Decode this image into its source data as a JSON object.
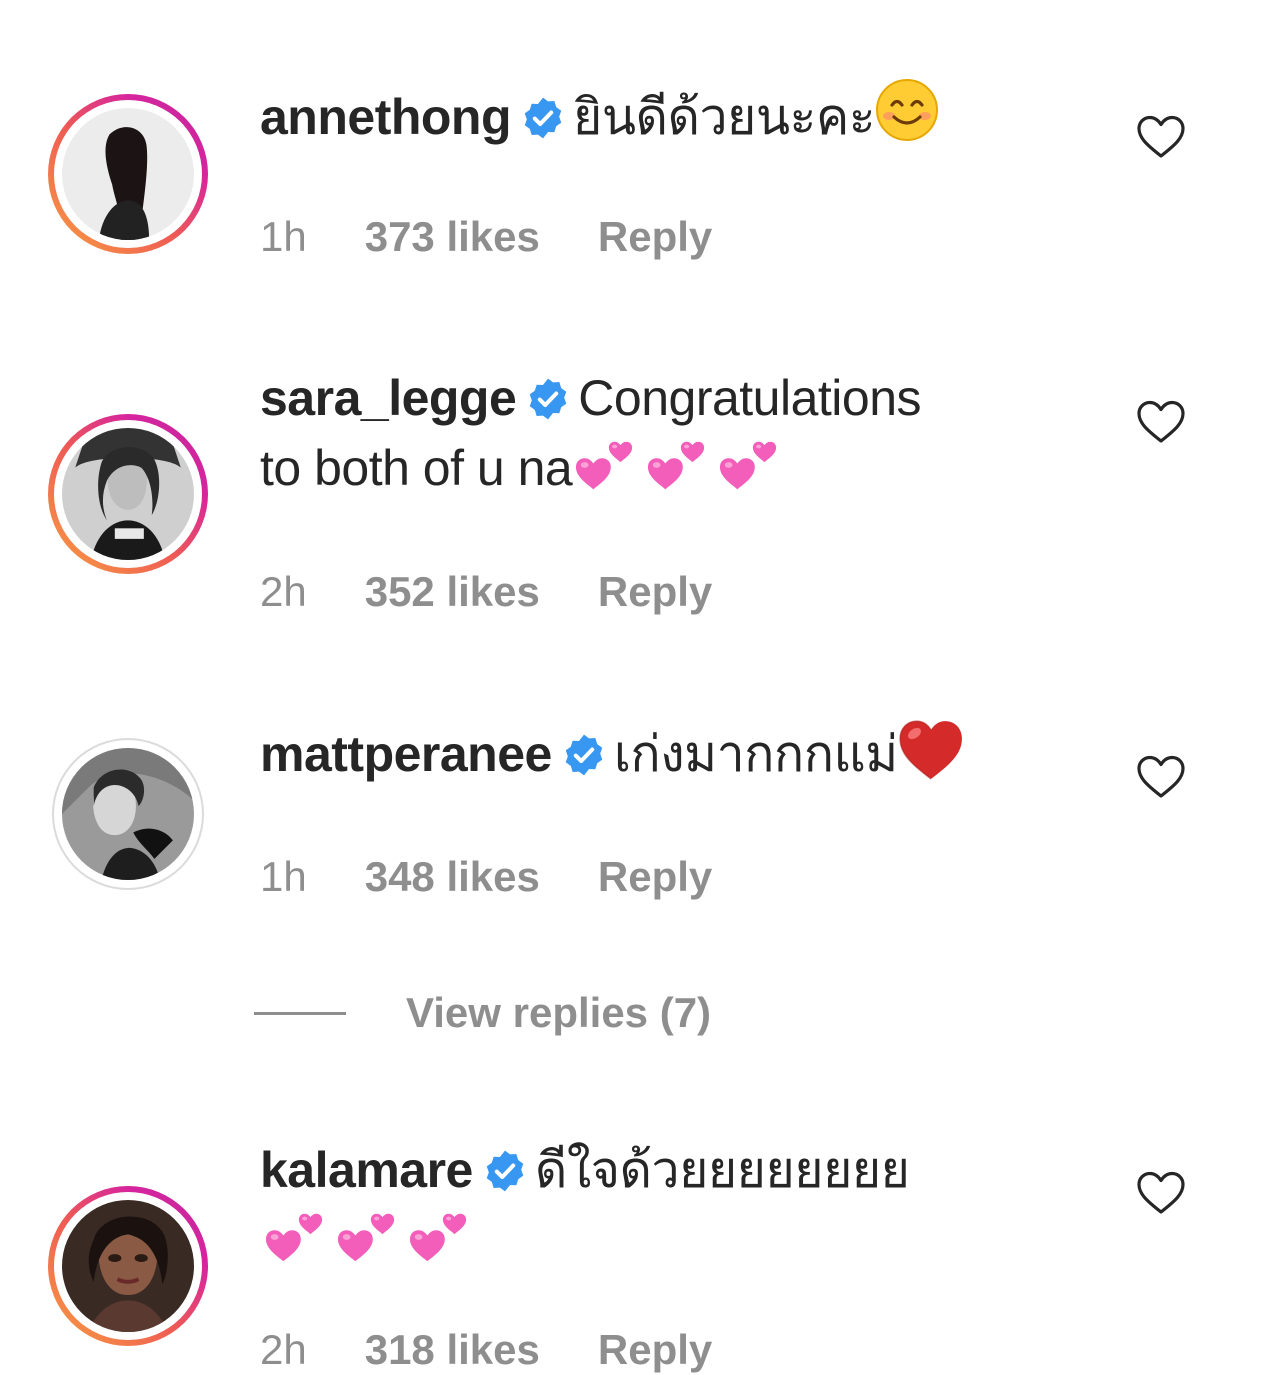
{
  "comments": [
    {
      "username": "annethong",
      "text": "ยินดีด้วยนะคะ",
      "emoji": "smiling-face-emoji",
      "time": "1h",
      "likes": "373 likes",
      "reply_label": "Reply"
    },
    {
      "username": "sara_legge",
      "text_line1": "Congratulations",
      "text_line2": "to both of u na",
      "emoji": "two-hearts-emoji",
      "time": "2h",
      "likes": "352 likes",
      "reply_label": "Reply"
    },
    {
      "username": "mattperanee",
      "text": "เก่งมากกกแม่",
      "emoji": "red-heart-emoji",
      "time": "1h",
      "likes": "348 likes",
      "reply_label": "Reply"
    },
    {
      "username": "kalamare",
      "text": "ดีใจด้วยยยยยยยย",
      "emoji": "two-hearts-emoji",
      "time": "2h",
      "likes": "318 likes",
      "reply_label": "Reply"
    }
  ],
  "view_replies_label": "View replies (7)",
  "colors": {
    "verified_blue": "#3897f0",
    "muted_text": "#8e8e8e",
    "primary_text": "#262626",
    "story_ring_start": "#f9a03f",
    "story_ring_end": "#c02a9a"
  }
}
